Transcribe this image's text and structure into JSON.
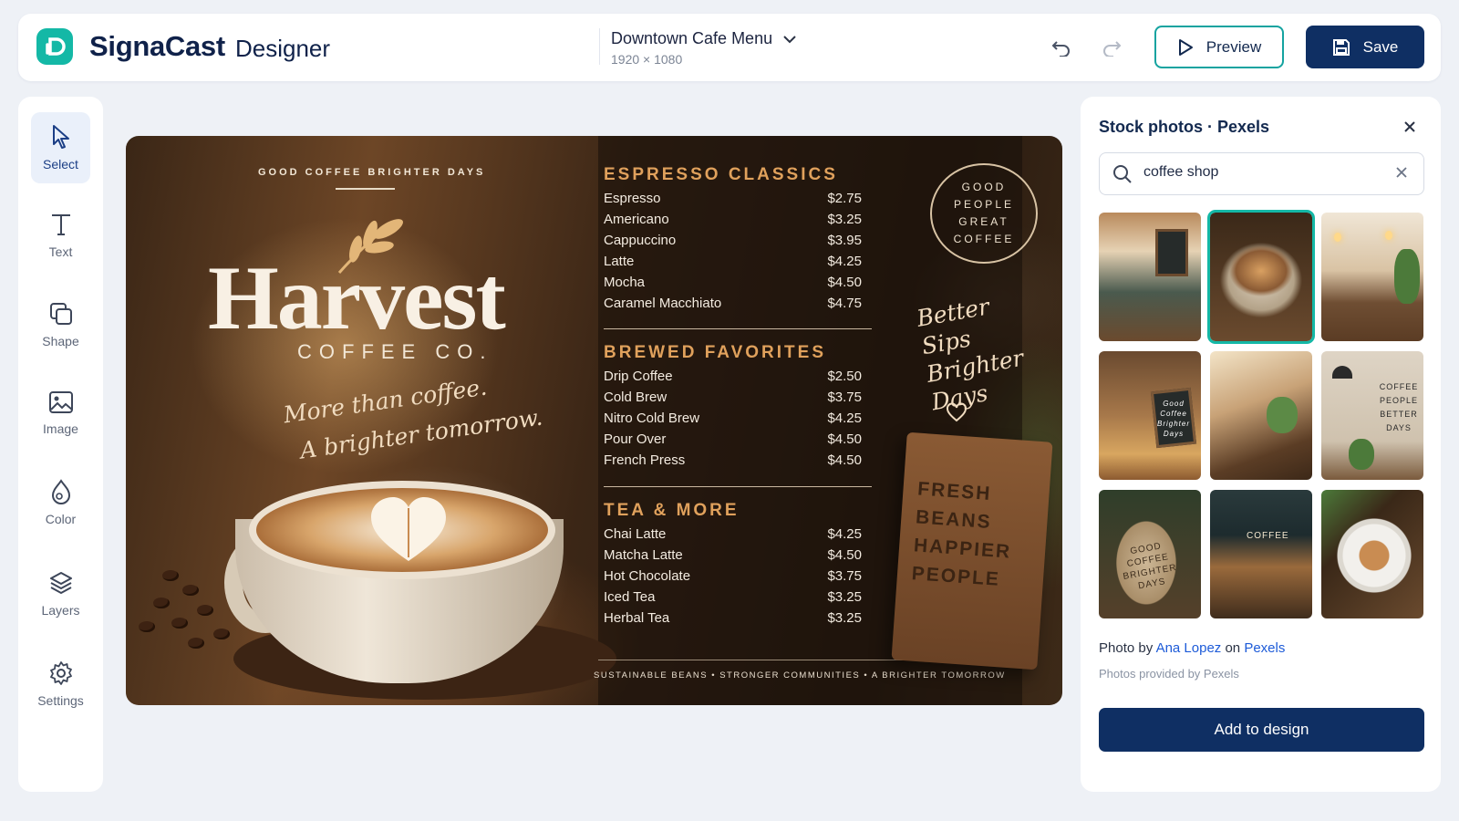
{
  "header": {
    "brand": "SignaCast",
    "product": "Designer",
    "document_title": "Downtown Cafe Menu",
    "document_size": "1920 × 1080",
    "preview_label": "Preview",
    "save_label": "Save"
  },
  "tools": [
    {
      "label": "Select",
      "icon": "pointer-icon"
    },
    {
      "label": "Text",
      "icon": "text-icon"
    },
    {
      "label": "Shape",
      "icon": "shape-icon"
    },
    {
      "label": "Image",
      "icon": "image-icon"
    },
    {
      "label": "Color",
      "icon": "paint-drop-icon"
    },
    {
      "label": "Layers",
      "icon": "layers-icon"
    },
    {
      "label": "Settings",
      "icon": "gear-icon"
    }
  ],
  "design": {
    "tagline_top": "GOOD COFFEE BRIGHTER DAYS",
    "brand_name": "Harvest",
    "brand_sub": "COFFEE CO.",
    "script_line1": "More than coffee.",
    "script_line2": "A brighter tomorrow.",
    "sections": [
      {
        "title": "ESPRESSO CLASSICS",
        "items": [
          {
            "name": "Espresso",
            "price": "$2.75"
          },
          {
            "name": "Americano",
            "price": "$3.25"
          },
          {
            "name": "Cappuccino",
            "price": "$3.95"
          },
          {
            "name": "Latte",
            "price": "$4.25"
          },
          {
            "name": "Mocha",
            "price": "$4.50"
          },
          {
            "name": "Caramel Macchiato",
            "price": "$4.75"
          }
        ]
      },
      {
        "title": "BREWED FAVORITES",
        "items": [
          {
            "name": "Drip Coffee",
            "price": "$2.50"
          },
          {
            "name": "Cold Brew",
            "price": "$3.75"
          },
          {
            "name": "Nitro Cold Brew",
            "price": "$4.25"
          },
          {
            "name": "Pour Over",
            "price": "$4.50"
          },
          {
            "name": "French Press",
            "price": "$4.50"
          }
        ]
      },
      {
        "title": "TEA & MORE",
        "items": [
          {
            "name": "Chai Latte",
            "price": "$4.25"
          },
          {
            "name": "Matcha Latte",
            "price": "$4.50"
          },
          {
            "name": "Hot Chocolate",
            "price": "$3.75"
          },
          {
            "name": "Iced Tea",
            "price": "$3.25"
          },
          {
            "name": "Herbal Tea",
            "price": "$3.25"
          }
        ]
      }
    ],
    "footer": "SUSTAINABLE BEANS  •  STRONGER COMMUNITIES  •  A BRIGHTER TOMORROW",
    "stamp_lines": [
      "GOOD",
      "PEOPLE",
      "GREAT",
      "COFFEE"
    ],
    "script_right": [
      "Better",
      "Sips",
      "Brighter",
      "Days"
    ],
    "sign_lines": [
      "FRESH",
      "BEANS",
      "HAPPIER",
      "PEOPLE"
    ]
  },
  "stock": {
    "title": "Stock photos · Pexels",
    "search_value": "coffee shop",
    "thumbs": [
      {
        "name": "cafe-interior-chalkboard",
        "caption": ""
      },
      {
        "name": "latte-art-cup",
        "caption": "",
        "selected": true
      },
      {
        "name": "cafe-counter-plants",
        "caption": ""
      },
      {
        "name": "pastry-case-sign",
        "caption": "Good Coffee Brighter Days"
      },
      {
        "name": "sunny-cafe-table",
        "caption": ""
      },
      {
        "name": "wall-lettering",
        "caption": "COFFEE PEOPLE BETTER DAYS"
      },
      {
        "name": "coffee-bean-sack",
        "caption": "GOOD COFFEE BRIGHTER DAYS"
      },
      {
        "name": "cafe-storefront",
        "caption": "COFFEE"
      },
      {
        "name": "latte-top-view",
        "caption": ""
      }
    ],
    "credit_prefix": "Photo by",
    "credit_author": "Ana Lopez",
    "credit_on": "on",
    "credit_site": "Pexels",
    "provided": "Photos provided by Pexels",
    "add_label": "Add to design"
  }
}
